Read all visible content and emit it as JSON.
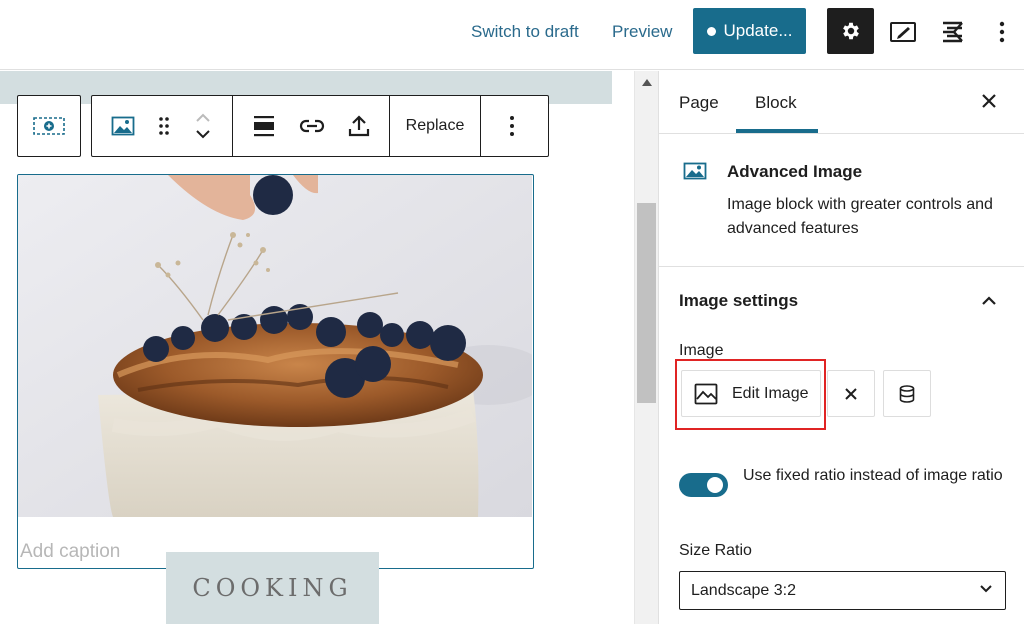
{
  "topbar": {
    "switch_to_draft": "Switch to draft",
    "preview": "Preview",
    "update": "Update...",
    "icons": [
      "gear-icon",
      "edit-mode-icon",
      "plugin-icon",
      "more-vertical-icon"
    ]
  },
  "toolbar": {
    "replace_label": "Replace",
    "icons": [
      "insert-block-icon",
      "image-icon",
      "drag-handle-icon",
      "move-up-icon",
      "move-down-icon",
      "align-icon",
      "link-icon",
      "upload-icon",
      "more-options-icon"
    ]
  },
  "canvas": {
    "caption_placeholder": "Add caption",
    "below_heading": "COOKING"
  },
  "sidebar": {
    "tabs": [
      {
        "label": "Page",
        "active": false
      },
      {
        "label": "Block",
        "active": true
      }
    ],
    "block": {
      "title": "Advanced Image",
      "description": "Image block with greater controls and advanced features"
    },
    "image_settings": {
      "title": "Image settings",
      "image_label": "Image",
      "edit_image_label": "Edit Image",
      "toggle_label": "Use fixed ratio instead of image ratio",
      "toggle_on": true,
      "size_ratio_label": "Size Ratio",
      "size_ratio_value": "Landscape 3:2"
    }
  },
  "colors": {
    "accent": "#186c8c",
    "highlight": "#e02424",
    "strip": "#d3dee0"
  }
}
